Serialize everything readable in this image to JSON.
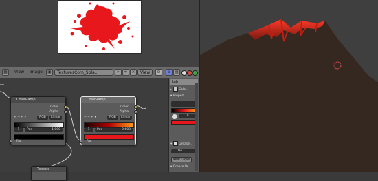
{
  "header": {
    "menu": [
      "View",
      "Image"
    ],
    "image_name": "TexturesCom_Spla...",
    "view_label": "View"
  },
  "nodes": {
    "left": {
      "title": "ColorRamp",
      "outputs": [
        "Color",
        "Alpha"
      ],
      "mode": "RGB",
      "interp": "Linear",
      "index": "1",
      "pos_label": "Pos",
      "pos_value": "1.000",
      "input": "Fac"
    },
    "right": {
      "title": "ColorRamp",
      "outputs": [
        "Color",
        "Alpha"
      ],
      "mode": "RGB",
      "interp": "Linear",
      "index": "1",
      "pos_label": "Pos",
      "pos_value": "0.603",
      "input": "Fac"
    },
    "bottom": {
      "title": "Texture"
    }
  },
  "properties": {
    "tab": "Lab",
    "items": [
      "Colo...",
      "Propert...",
      "Grease...",
      "Ne...",
      "New Layer",
      "Grease Pe..."
    ],
    "swatch_label": "0"
  },
  "colors": {
    "accent_red": "#e8171b",
    "mountain": "#342820",
    "viewport_bg": "#3f3f3f",
    "node_bg": "#5b5b5b",
    "header_bg": "#6b6b6b"
  }
}
